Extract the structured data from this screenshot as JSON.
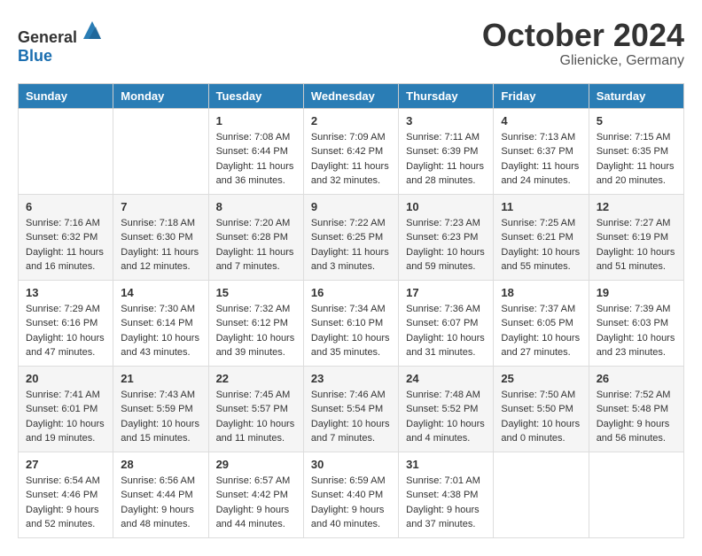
{
  "logo": {
    "text_general": "General",
    "text_blue": "Blue"
  },
  "header": {
    "month": "October 2024",
    "location": "Glienicke, Germany"
  },
  "weekdays": [
    "Sunday",
    "Monday",
    "Tuesday",
    "Wednesday",
    "Thursday",
    "Friday",
    "Saturday"
  ],
  "weeks": [
    [
      {
        "day": "",
        "sunrise": "",
        "sunset": "",
        "daylight": ""
      },
      {
        "day": "",
        "sunrise": "",
        "sunset": "",
        "daylight": ""
      },
      {
        "day": "1",
        "sunrise": "Sunrise: 7:08 AM",
        "sunset": "Sunset: 6:44 PM",
        "daylight": "Daylight: 11 hours and 36 minutes."
      },
      {
        "day": "2",
        "sunrise": "Sunrise: 7:09 AM",
        "sunset": "Sunset: 6:42 PM",
        "daylight": "Daylight: 11 hours and 32 minutes."
      },
      {
        "day": "3",
        "sunrise": "Sunrise: 7:11 AM",
        "sunset": "Sunset: 6:39 PM",
        "daylight": "Daylight: 11 hours and 28 minutes."
      },
      {
        "day": "4",
        "sunrise": "Sunrise: 7:13 AM",
        "sunset": "Sunset: 6:37 PM",
        "daylight": "Daylight: 11 hours and 24 minutes."
      },
      {
        "day": "5",
        "sunrise": "Sunrise: 7:15 AM",
        "sunset": "Sunset: 6:35 PM",
        "daylight": "Daylight: 11 hours and 20 minutes."
      }
    ],
    [
      {
        "day": "6",
        "sunrise": "Sunrise: 7:16 AM",
        "sunset": "Sunset: 6:32 PM",
        "daylight": "Daylight: 11 hours and 16 minutes."
      },
      {
        "day": "7",
        "sunrise": "Sunrise: 7:18 AM",
        "sunset": "Sunset: 6:30 PM",
        "daylight": "Daylight: 11 hours and 12 minutes."
      },
      {
        "day": "8",
        "sunrise": "Sunrise: 7:20 AM",
        "sunset": "Sunset: 6:28 PM",
        "daylight": "Daylight: 11 hours and 7 minutes."
      },
      {
        "day": "9",
        "sunrise": "Sunrise: 7:22 AM",
        "sunset": "Sunset: 6:25 PM",
        "daylight": "Daylight: 11 hours and 3 minutes."
      },
      {
        "day": "10",
        "sunrise": "Sunrise: 7:23 AM",
        "sunset": "Sunset: 6:23 PM",
        "daylight": "Daylight: 10 hours and 59 minutes."
      },
      {
        "day": "11",
        "sunrise": "Sunrise: 7:25 AM",
        "sunset": "Sunset: 6:21 PM",
        "daylight": "Daylight: 10 hours and 55 minutes."
      },
      {
        "day": "12",
        "sunrise": "Sunrise: 7:27 AM",
        "sunset": "Sunset: 6:19 PM",
        "daylight": "Daylight: 10 hours and 51 minutes."
      }
    ],
    [
      {
        "day": "13",
        "sunrise": "Sunrise: 7:29 AM",
        "sunset": "Sunset: 6:16 PM",
        "daylight": "Daylight: 10 hours and 47 minutes."
      },
      {
        "day": "14",
        "sunrise": "Sunrise: 7:30 AM",
        "sunset": "Sunset: 6:14 PM",
        "daylight": "Daylight: 10 hours and 43 minutes."
      },
      {
        "day": "15",
        "sunrise": "Sunrise: 7:32 AM",
        "sunset": "Sunset: 6:12 PM",
        "daylight": "Daylight: 10 hours and 39 minutes."
      },
      {
        "day": "16",
        "sunrise": "Sunrise: 7:34 AM",
        "sunset": "Sunset: 6:10 PM",
        "daylight": "Daylight: 10 hours and 35 minutes."
      },
      {
        "day": "17",
        "sunrise": "Sunrise: 7:36 AM",
        "sunset": "Sunset: 6:07 PM",
        "daylight": "Daylight: 10 hours and 31 minutes."
      },
      {
        "day": "18",
        "sunrise": "Sunrise: 7:37 AM",
        "sunset": "Sunset: 6:05 PM",
        "daylight": "Daylight: 10 hours and 27 minutes."
      },
      {
        "day": "19",
        "sunrise": "Sunrise: 7:39 AM",
        "sunset": "Sunset: 6:03 PM",
        "daylight": "Daylight: 10 hours and 23 minutes."
      }
    ],
    [
      {
        "day": "20",
        "sunrise": "Sunrise: 7:41 AM",
        "sunset": "Sunset: 6:01 PM",
        "daylight": "Daylight: 10 hours and 19 minutes."
      },
      {
        "day": "21",
        "sunrise": "Sunrise: 7:43 AM",
        "sunset": "Sunset: 5:59 PM",
        "daylight": "Daylight: 10 hours and 15 minutes."
      },
      {
        "day": "22",
        "sunrise": "Sunrise: 7:45 AM",
        "sunset": "Sunset: 5:57 PM",
        "daylight": "Daylight: 10 hours and 11 minutes."
      },
      {
        "day": "23",
        "sunrise": "Sunrise: 7:46 AM",
        "sunset": "Sunset: 5:54 PM",
        "daylight": "Daylight: 10 hours and 7 minutes."
      },
      {
        "day": "24",
        "sunrise": "Sunrise: 7:48 AM",
        "sunset": "Sunset: 5:52 PM",
        "daylight": "Daylight: 10 hours and 4 minutes."
      },
      {
        "day": "25",
        "sunrise": "Sunrise: 7:50 AM",
        "sunset": "Sunset: 5:50 PM",
        "daylight": "Daylight: 10 hours and 0 minutes."
      },
      {
        "day": "26",
        "sunrise": "Sunrise: 7:52 AM",
        "sunset": "Sunset: 5:48 PM",
        "daylight": "Daylight: 9 hours and 56 minutes."
      }
    ],
    [
      {
        "day": "27",
        "sunrise": "Sunrise: 6:54 AM",
        "sunset": "Sunset: 4:46 PM",
        "daylight": "Daylight: 9 hours and 52 minutes."
      },
      {
        "day": "28",
        "sunrise": "Sunrise: 6:56 AM",
        "sunset": "Sunset: 4:44 PM",
        "daylight": "Daylight: 9 hours and 48 minutes."
      },
      {
        "day": "29",
        "sunrise": "Sunrise: 6:57 AM",
        "sunset": "Sunset: 4:42 PM",
        "daylight": "Daylight: 9 hours and 44 minutes."
      },
      {
        "day": "30",
        "sunrise": "Sunrise: 6:59 AM",
        "sunset": "Sunset: 4:40 PM",
        "daylight": "Daylight: 9 hours and 40 minutes."
      },
      {
        "day": "31",
        "sunrise": "Sunrise: 7:01 AM",
        "sunset": "Sunset: 4:38 PM",
        "daylight": "Daylight: 9 hours and 37 minutes."
      },
      {
        "day": "",
        "sunrise": "",
        "sunset": "",
        "daylight": ""
      },
      {
        "day": "",
        "sunrise": "",
        "sunset": "",
        "daylight": ""
      }
    ]
  ]
}
